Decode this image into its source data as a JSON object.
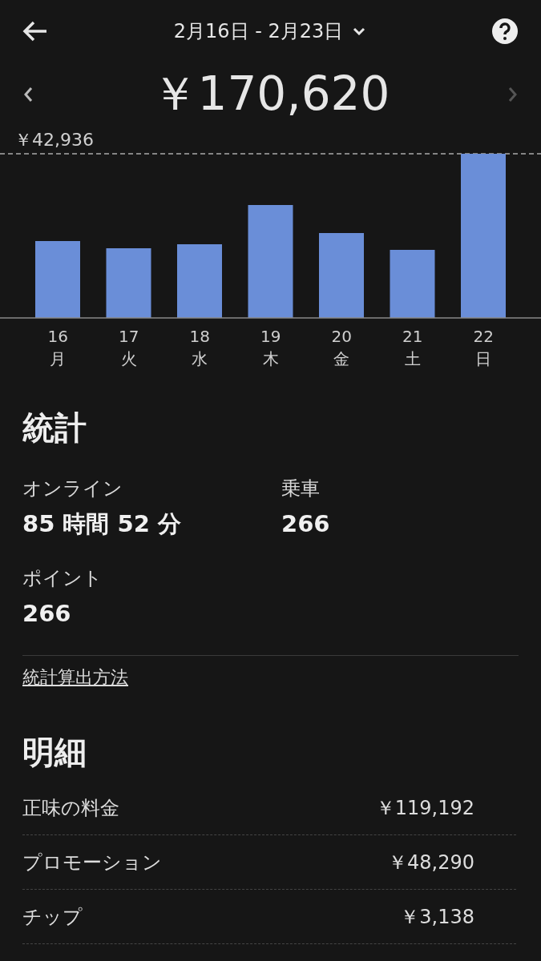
{
  "header": {
    "date_range": "2月16日 - 2月23日",
    "total": "￥170,620"
  },
  "chart": {
    "max_label": "￥42,936",
    "days": [
      {
        "day": "16",
        "weekday": "月"
      },
      {
        "day": "17",
        "weekday": "火"
      },
      {
        "day": "18",
        "weekday": "水"
      },
      {
        "day": "19",
        "weekday": "木"
      },
      {
        "day": "20",
        "weekday": "金"
      },
      {
        "day": "21",
        "weekday": "土"
      },
      {
        "day": "22",
        "weekday": "日"
      }
    ]
  },
  "stats": {
    "title": "統計",
    "items": [
      {
        "label": "オンライン",
        "value": "85 時間 52 分"
      },
      {
        "label": "乗車",
        "value": "266"
      },
      {
        "label": "ポイント",
        "value": "266"
      }
    ],
    "link": "統計算出方法"
  },
  "breakdown": {
    "title": "明細",
    "rows": [
      {
        "label": "正味の料金",
        "amount": "￥119,192"
      },
      {
        "label": "プロモーション",
        "amount": "￥48,290"
      },
      {
        "label": "チップ",
        "amount": "￥3,138"
      }
    ]
  }
}
